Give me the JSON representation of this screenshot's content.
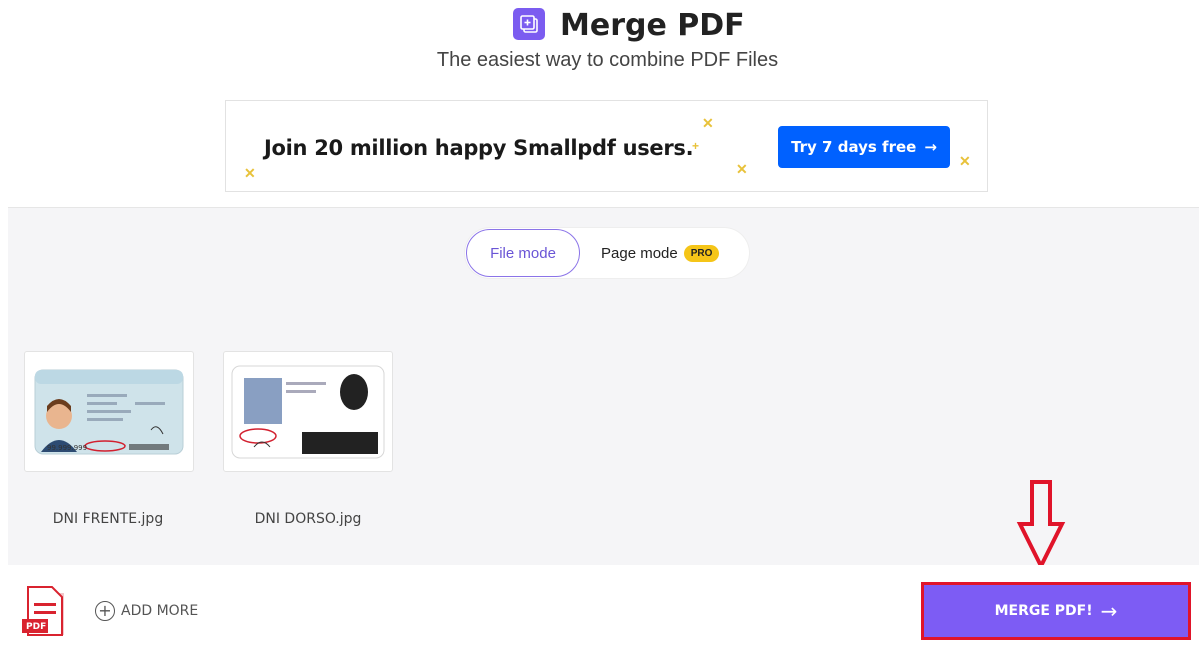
{
  "header": {
    "logo_icon": "merge-pdf-icon",
    "title": "Merge PDF",
    "subtitle": "The easiest way to combine PDF Files"
  },
  "banner": {
    "text": "Join 20 million happy Smallpdf users.",
    "cta_label": "Try 7 days free",
    "cta_icon": "arrow-right-icon",
    "cta_color": "#0061ff"
  },
  "mode_toggle": {
    "file_mode": "File mode",
    "page_mode": "Page mode",
    "pro_badge": "PRO"
  },
  "files": [
    {
      "name": "DNI FRENTE.jpg"
    },
    {
      "name": "DNI DORSO.jpg"
    }
  ],
  "bottom_bar": {
    "file_type_icon": "pdf-file-icon",
    "pdf_label": "PDF",
    "add_more_label": "ADD MORE",
    "merge_label": "MERGE PDF!",
    "merge_icon": "arrow-right-icon",
    "accent": "#7d5cf4",
    "highlight": "#e0142a"
  }
}
